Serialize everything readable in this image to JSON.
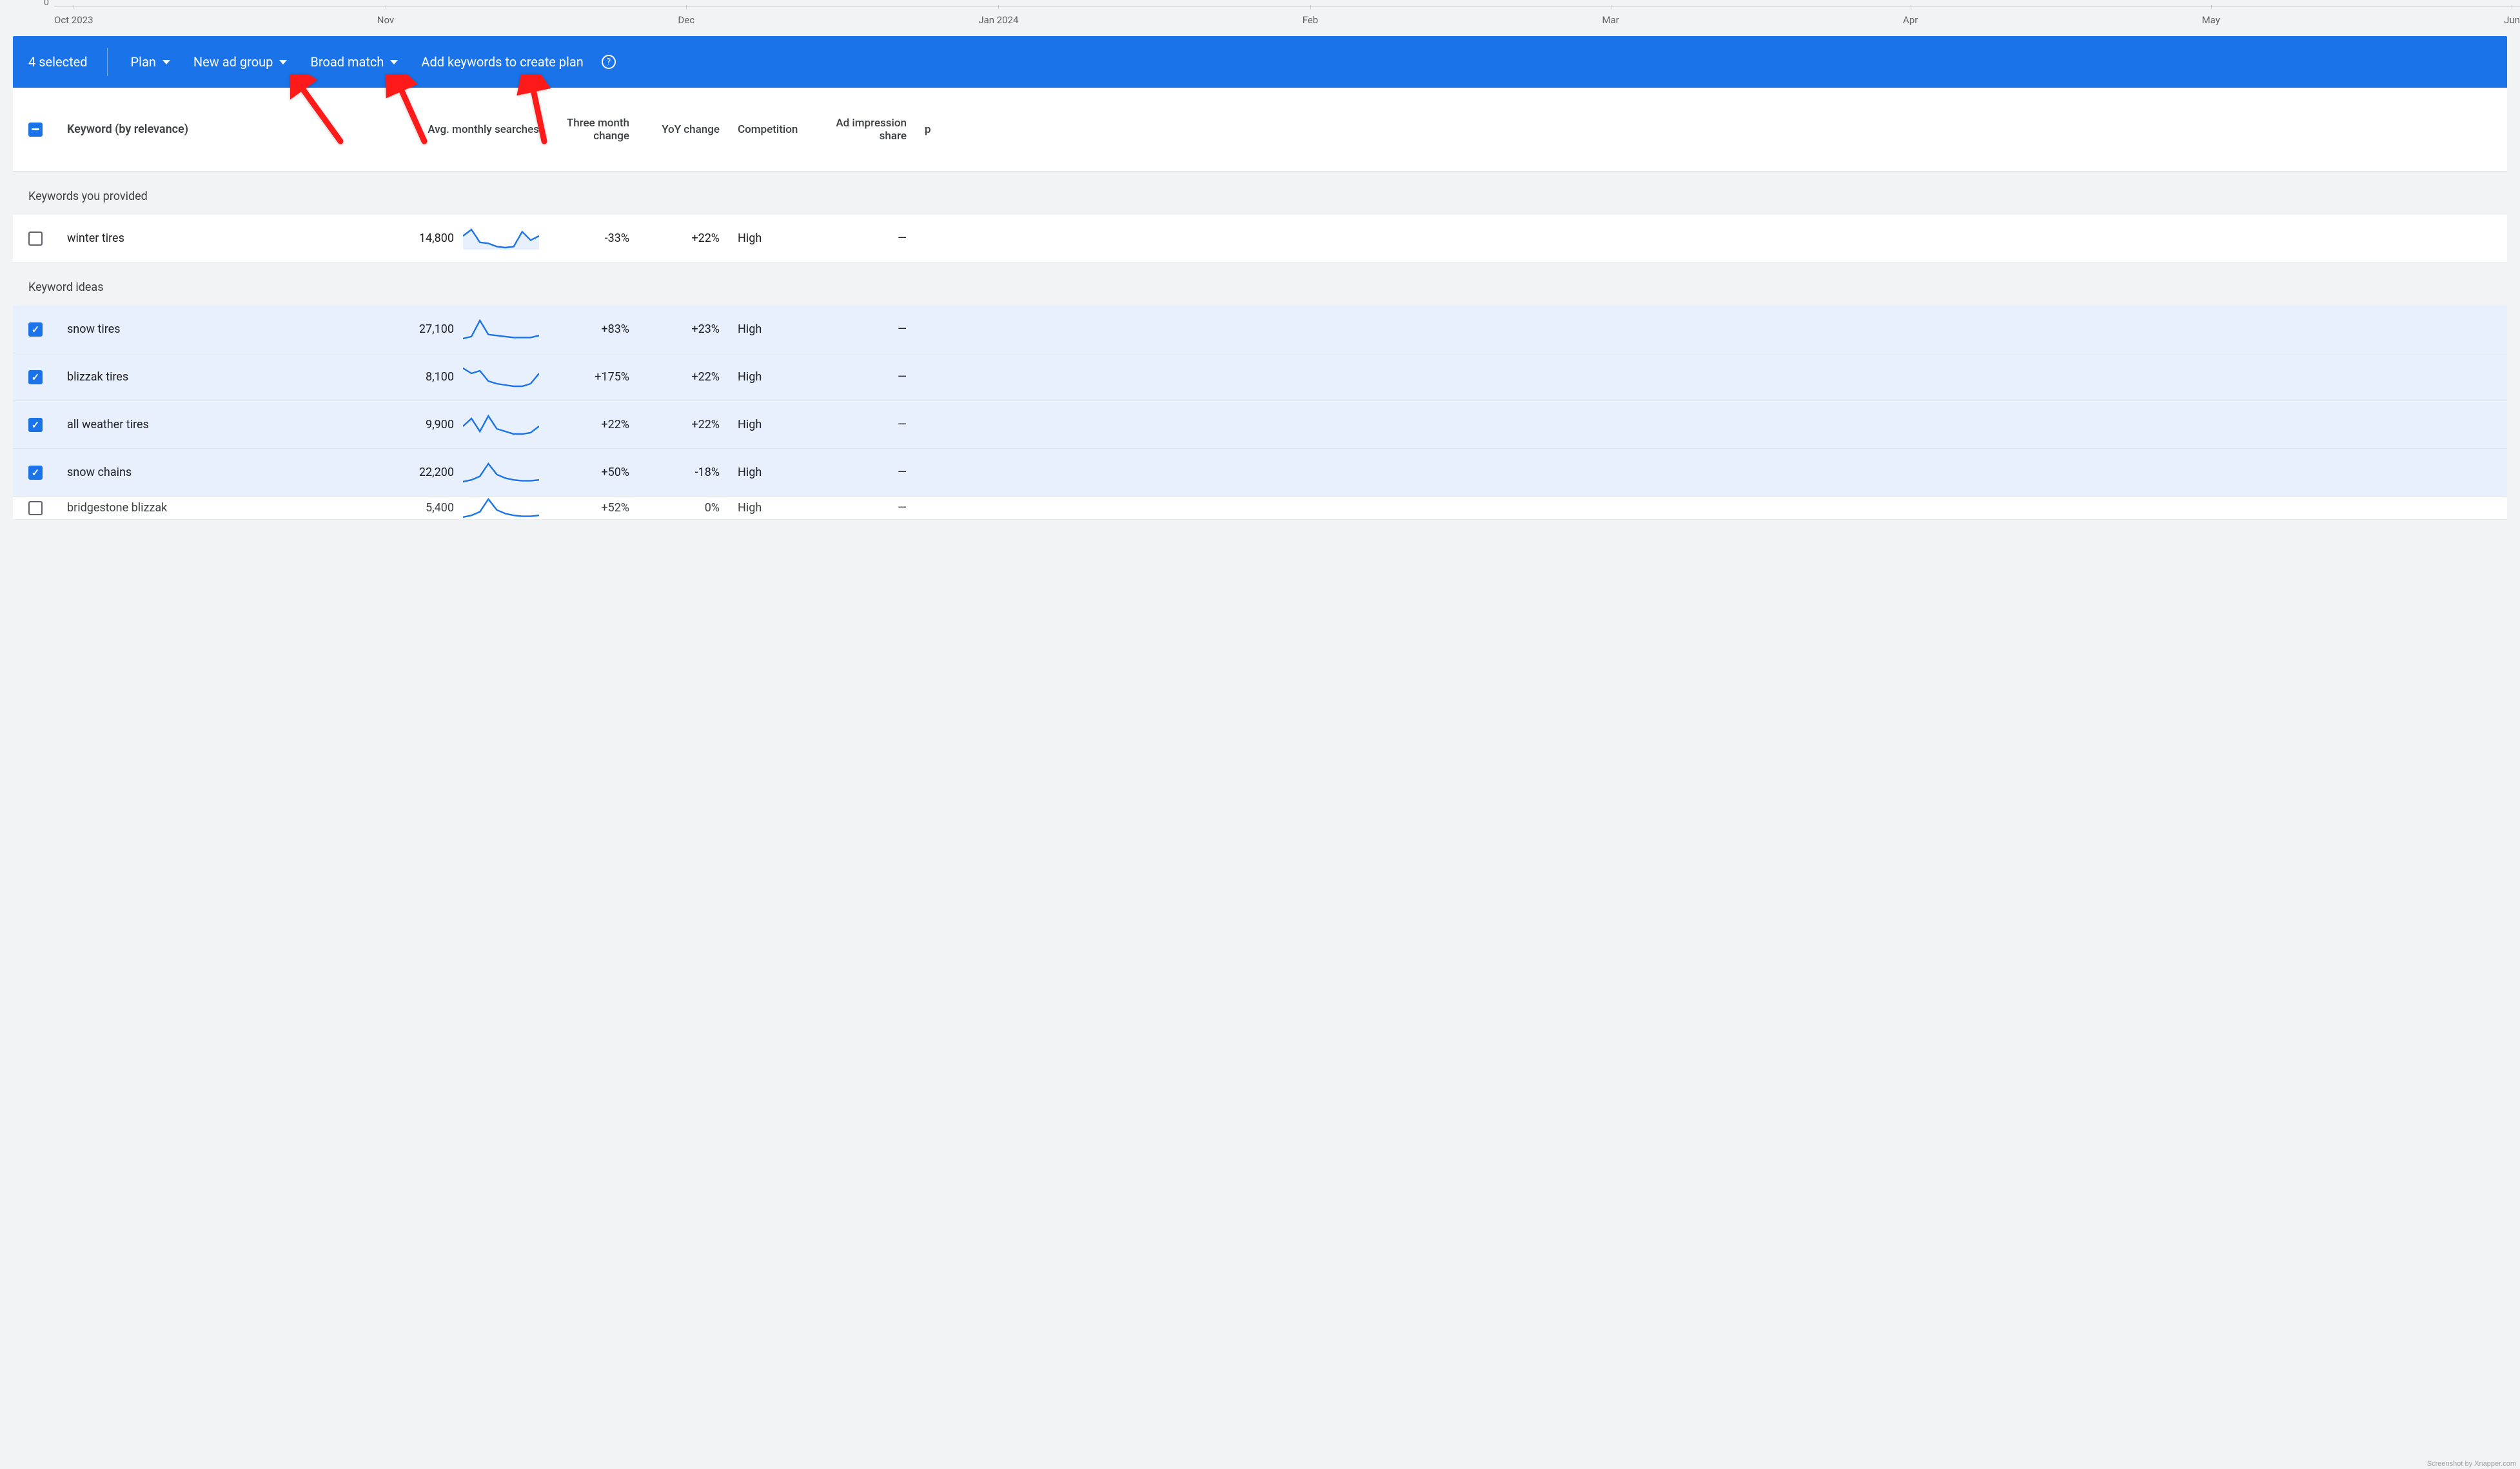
{
  "timeline": {
    "zero": "0",
    "labels": [
      "Oct 2023",
      "Nov",
      "Dec",
      "Jan 2024",
      "Feb",
      "Mar",
      "Apr",
      "May",
      "Jun"
    ]
  },
  "actionbar": {
    "selected": "4 selected",
    "plan": "Plan",
    "adgroup": "New ad group",
    "match": "Broad match",
    "add": "Add keywords to create plan",
    "help": "?"
  },
  "headers": {
    "keyword": "Keyword (by relevance)",
    "avg": "Avg. monthly searches",
    "three": "Three month change",
    "yoy": "YoY change",
    "comp": "Competition",
    "imp": "Ad impression share",
    "last": "p"
  },
  "sections": {
    "provided": "Keywords you provided",
    "ideas": "Keyword ideas"
  },
  "rows_provided": [
    {
      "checked": false,
      "kw": "winter tires",
      "avg": "14,800",
      "three": "-33%",
      "yoy": "+22%",
      "comp": "High",
      "imp": "—"
    }
  ],
  "rows_ideas": [
    {
      "checked": true,
      "kw": "snow tires",
      "avg": "27,100",
      "three": "+83%",
      "yoy": "+23%",
      "comp": "High",
      "imp": "—"
    },
    {
      "checked": true,
      "kw": "blizzak tires",
      "avg": "8,100",
      "three": "+175%",
      "yoy": "+22%",
      "comp": "High",
      "imp": "—"
    },
    {
      "checked": true,
      "kw": "all weather tires",
      "avg": "9,900",
      "three": "+22%",
      "yoy": "+22%",
      "comp": "High",
      "imp": "—"
    },
    {
      "checked": true,
      "kw": "snow chains",
      "avg": "22,200",
      "three": "+50%",
      "yoy": "-18%",
      "comp": "High",
      "imp": "—"
    },
    {
      "checked": false,
      "kw": "bridgestone blizzak",
      "avg": "5,400",
      "three": "+52%",
      "yoy": "0%",
      "comp": "High",
      "imp": "—"
    }
  ],
  "watermark": "Screenshot by Xnapper.com",
  "chart_data": [
    {
      "type": "line",
      "title": "winter tires sparkline",
      "values": [
        20,
        26,
        14,
        13,
        10,
        9,
        10,
        24,
        16,
        20
      ]
    },
    {
      "type": "line",
      "title": "snow tires sparkline",
      "values": [
        10,
        12,
        28,
        14,
        13,
        12,
        11,
        11,
        11,
        13
      ]
    },
    {
      "type": "line",
      "title": "blizzak tires sparkline",
      "values": [
        24,
        20,
        22,
        14,
        12,
        11,
        10,
        10,
        12,
        20
      ]
    },
    {
      "type": "line",
      "title": "all weather tires sparkline",
      "values": [
        16,
        22,
        12,
        24,
        14,
        12,
        10,
        10,
        11,
        16
      ]
    },
    {
      "type": "line",
      "title": "snow chains sparkline",
      "values": [
        8,
        10,
        14,
        28,
        16,
        12,
        10,
        9,
        9,
        10
      ]
    }
  ]
}
